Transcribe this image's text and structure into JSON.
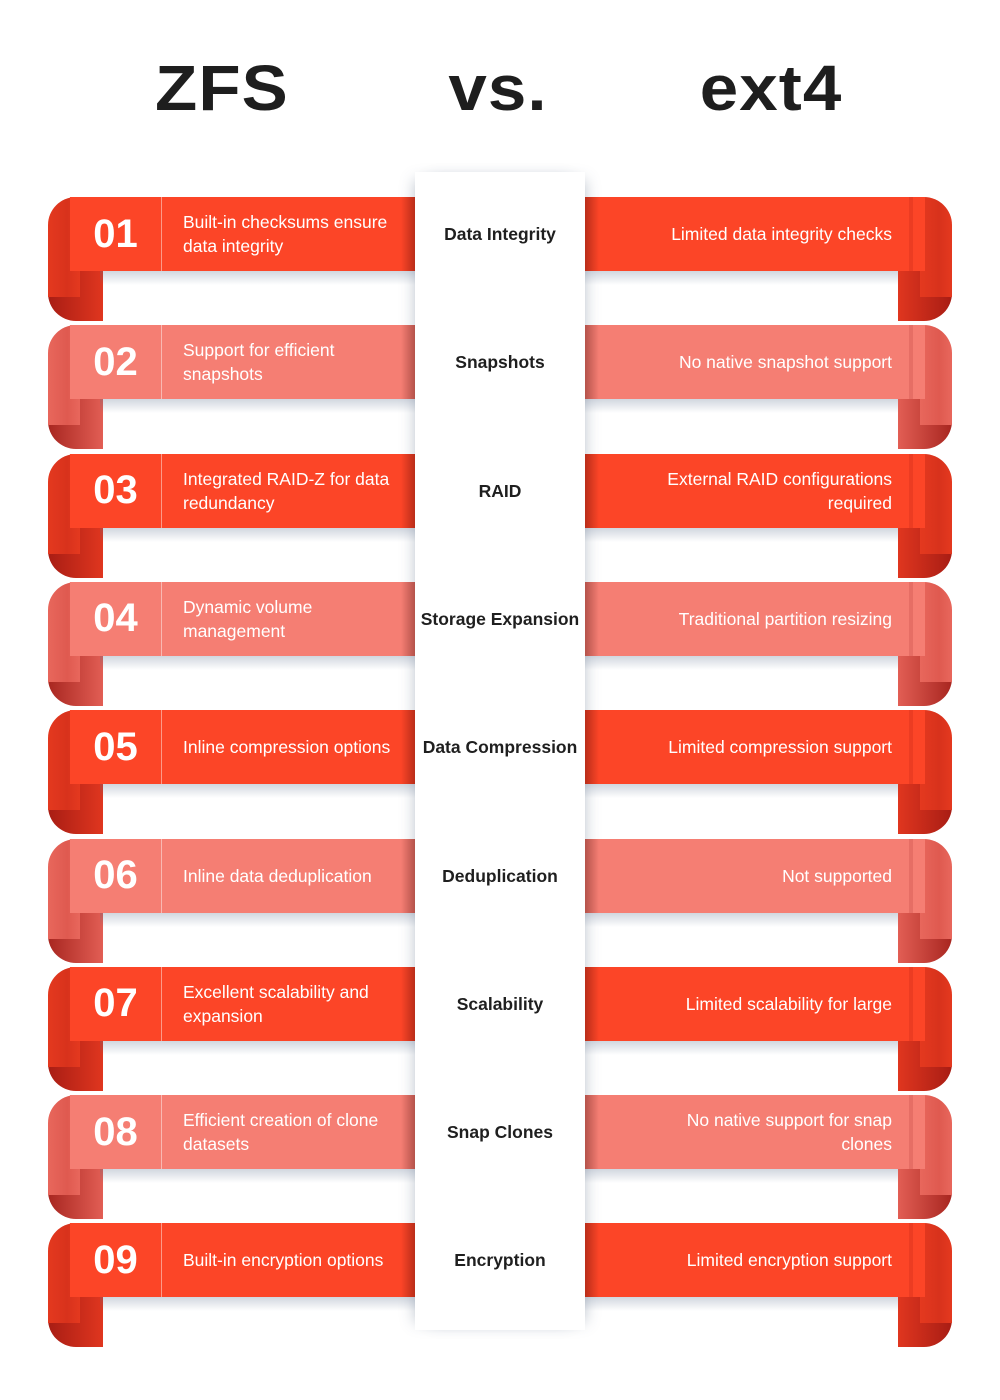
{
  "header": {
    "left_title": "ZFS",
    "middle_title": "vs.",
    "right_title": "ext4"
  },
  "theme": {
    "dark_red": "#fc4527",
    "light_red": "#f57e73",
    "text_dark": "#1f1f1f"
  },
  "rows": [
    {
      "number": "01",
      "feature": "Data Integrity",
      "zfs": "Built-in checksums ensure data integrity",
      "ext4": "Limited data integrity checks",
      "style": "dark"
    },
    {
      "number": "02",
      "feature": "Snapshots",
      "zfs": "Support for efficient snapshots",
      "ext4": "No native snapshot support",
      "style": "light"
    },
    {
      "number": "03",
      "feature": "RAID",
      "zfs": "Integrated RAID-Z for data redundancy",
      "ext4": "External RAID configurations required",
      "style": "dark"
    },
    {
      "number": "04",
      "feature": "Storage Expansion",
      "zfs": "Dynamic volume management",
      "ext4": "Traditional partition resizing",
      "style": "light"
    },
    {
      "number": "05",
      "feature": "Data Compression",
      "zfs": "Inline compression options",
      "ext4": "Limited compression support",
      "style": "dark"
    },
    {
      "number": "06",
      "feature": "Deduplication",
      "zfs": "Inline data deduplication",
      "ext4": "Not supported",
      "style": "light"
    },
    {
      "number": "07",
      "feature": "Scalability",
      "zfs": "Excellent scalability and expansion",
      "ext4": "Limited scalability for large",
      "style": "dark"
    },
    {
      "number": "08",
      "feature": "Snap Clones",
      "zfs": "Efficient creation of clone datasets",
      "ext4": "No native support for snap clones",
      "style": "light"
    },
    {
      "number": "09",
      "feature": "Encryption",
      "zfs": "Built-in encryption options",
      "ext4": "Limited encryption support",
      "style": "dark"
    }
  ]
}
